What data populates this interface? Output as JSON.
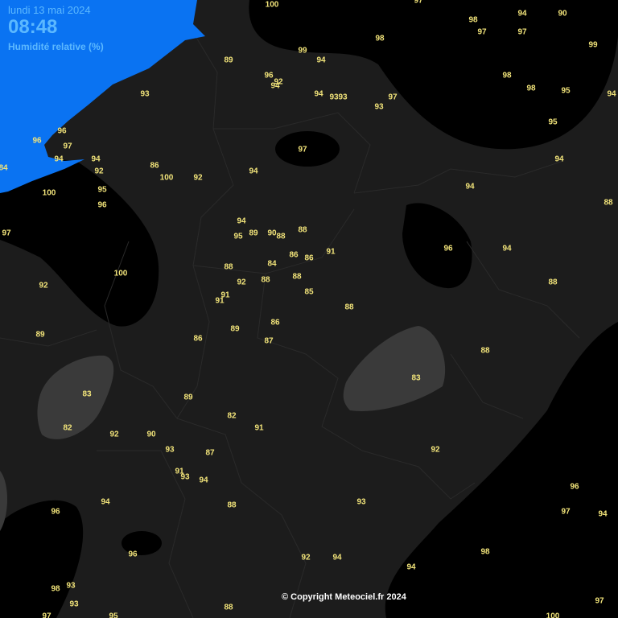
{
  "header": {
    "date": "lundi 13 mai 2024",
    "time": "08:48",
    "variable": "Humidité relative (%)"
  },
  "copyright": "© Copyright Meteociel.fr 2024",
  "colors": {
    "sea": "#0a73f2",
    "background": "#1c1c1c",
    "very_humid_zone": "#000000",
    "less_humid_zone": "#3a3a3a",
    "header_text": "#5bb8ff",
    "value_text": "#f2e47a",
    "borders": "#2b2b2b"
  },
  "stations": [
    {
      "v": "100"
    },
    {
      "v": "97"
    },
    {
      "v": "98"
    },
    {
      "v": "94"
    },
    {
      "v": "90"
    },
    {
      "v": "97"
    },
    {
      "v": "97"
    },
    {
      "v": "98"
    },
    {
      "v": "89"
    },
    {
      "v": "99"
    },
    {
      "v": "94"
    },
    {
      "v": "99"
    },
    {
      "v": "98"
    },
    {
      "v": "96"
    },
    {
      "v": "92"
    },
    {
      "v": "94"
    },
    {
      "v": "98"
    },
    {
      "v": "95"
    },
    {
      "v": "93"
    },
    {
      "v": "94"
    },
    {
      "v": "93"
    },
    {
      "v": "93"
    },
    {
      "v": "97"
    },
    {
      "v": "93"
    },
    {
      "v": "94"
    },
    {
      "v": "96"
    },
    {
      "v": "95"
    },
    {
      "v": "97"
    },
    {
      "v": "96"
    },
    {
      "v": "97"
    },
    {
      "v": "94"
    },
    {
      "v": "94"
    },
    {
      "v": "92"
    },
    {
      "v": "86"
    },
    {
      "v": "100"
    },
    {
      "v": "92"
    },
    {
      "v": "94"
    },
    {
      "v": "84"
    },
    {
      "v": "94"
    },
    {
      "v": "95"
    },
    {
      "v": "100"
    },
    {
      "v": "96"
    },
    {
      "v": "88"
    },
    {
      "v": "94"
    },
    {
      "v": "97"
    },
    {
      "v": "95"
    },
    {
      "v": "89"
    },
    {
      "v": "90"
    },
    {
      "v": "88"
    },
    {
      "v": "88"
    },
    {
      "v": "94"
    },
    {
      "v": "96"
    },
    {
      "v": "94"
    },
    {
      "v": "91"
    },
    {
      "v": "86"
    },
    {
      "v": "86"
    },
    {
      "v": "88"
    },
    {
      "v": "84"
    },
    {
      "v": "100"
    },
    {
      "v": "88"
    },
    {
      "v": "92"
    },
    {
      "v": "92"
    },
    {
      "v": "88"
    },
    {
      "v": "91"
    },
    {
      "v": "85"
    },
    {
      "v": "91"
    },
    {
      "v": "88"
    },
    {
      "v": "88"
    },
    {
      "v": "89"
    },
    {
      "v": "89"
    },
    {
      "v": "86"
    },
    {
      "v": "86"
    },
    {
      "v": "87"
    },
    {
      "v": "88"
    },
    {
      "v": "83"
    },
    {
      "v": "83"
    },
    {
      "v": "89"
    },
    {
      "v": "82"
    },
    {
      "v": "91"
    },
    {
      "v": "82"
    },
    {
      "v": "92"
    },
    {
      "v": "90"
    },
    {
      "v": "93"
    },
    {
      "v": "87"
    },
    {
      "v": "92"
    },
    {
      "v": "91"
    },
    {
      "v": "93"
    },
    {
      "v": "94"
    },
    {
      "v": "96"
    },
    {
      "v": "94"
    },
    {
      "v": "88"
    },
    {
      "v": "93"
    },
    {
      "v": "96"
    },
    {
      "v": "97"
    },
    {
      "v": "94"
    },
    {
      "v": "96"
    },
    {
      "v": "98"
    },
    {
      "v": "92"
    },
    {
      "v": "94"
    },
    {
      "v": "94"
    },
    {
      "v": "93"
    },
    {
      "v": "98"
    },
    {
      "v": "93"
    },
    {
      "v": "97"
    },
    {
      "v": "97"
    },
    {
      "v": "95"
    },
    {
      "v": "88"
    },
    {
      "v": "100"
    }
  ]
}
